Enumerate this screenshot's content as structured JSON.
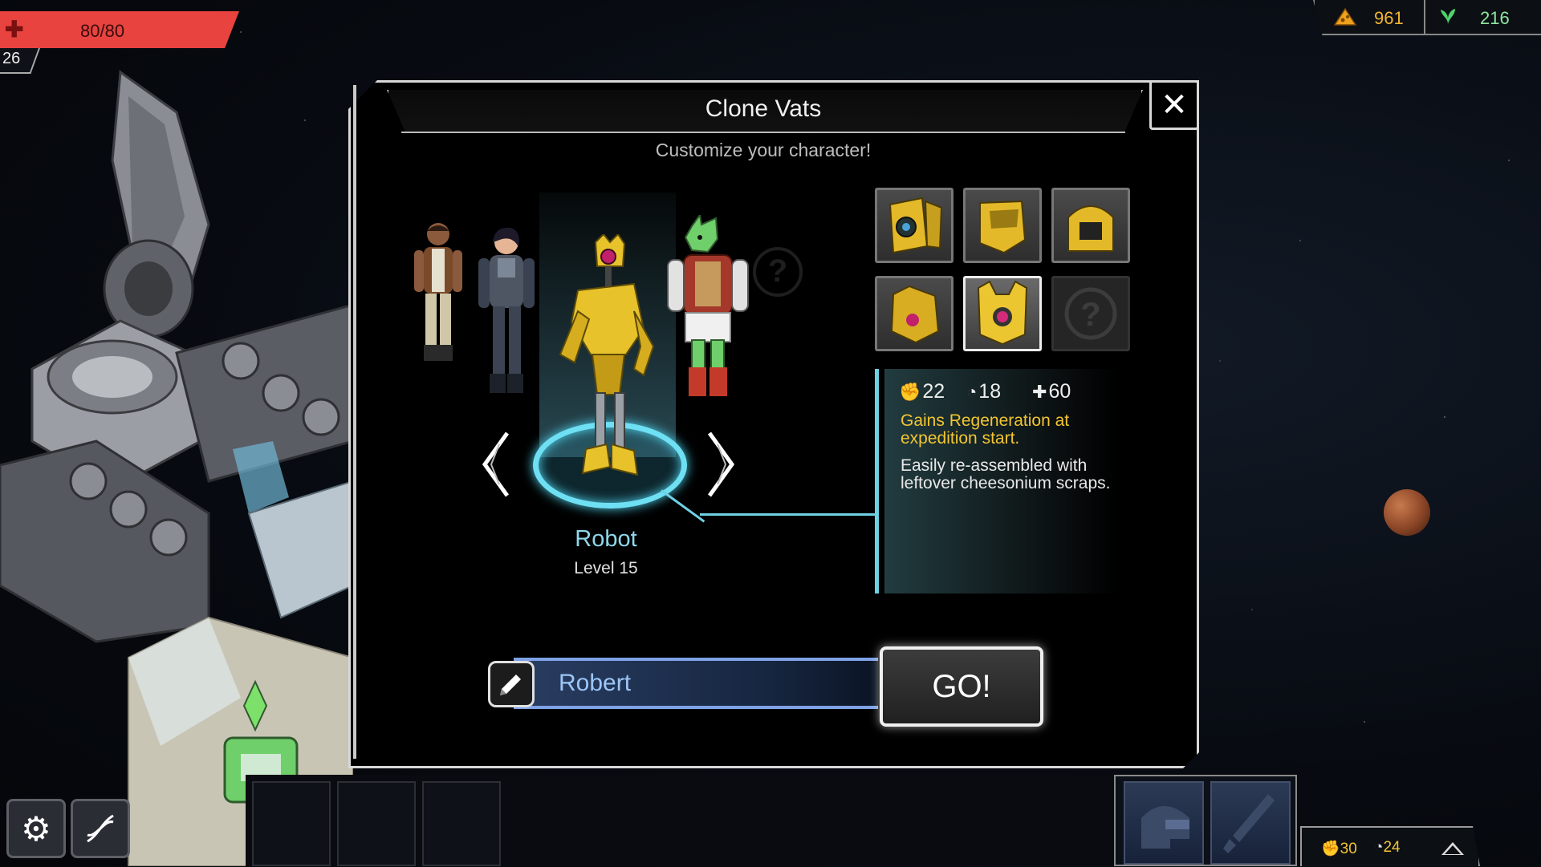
{
  "hud": {
    "health": "80/80",
    "player_level": "26",
    "resource_cheese": "961",
    "resource_herb": "216"
  },
  "dialog": {
    "title": "Clone Vats",
    "subtitle": "Customize your character!",
    "close_label": "✕"
  },
  "character": {
    "name": "Robot",
    "level": "Level 15",
    "stats": {
      "attack": "22",
      "speed": "18",
      "health": "60"
    },
    "ability": "Gains Regeneration at expedition start.",
    "description": "Easily re-assembled with leftover cheesonium scraps.",
    "arrow_prev": "‹",
    "arrow_next": "›",
    "unknown_mark": "?"
  },
  "portraits": [
    {
      "name": "robot-head-variant-1",
      "state": "normal"
    },
    {
      "name": "robot-head-variant-2",
      "state": "normal"
    },
    {
      "name": "robot-head-variant-3",
      "state": "normal"
    },
    {
      "name": "robot-head-variant-4",
      "state": "normal"
    },
    {
      "name": "robot-head-variant-5",
      "state": "selected"
    },
    {
      "name": "locked-variant",
      "state": "locked",
      "label": "?"
    }
  ],
  "name_input": {
    "value": "Robert"
  },
  "go_button": "GO!",
  "bottom_hud": {
    "attack": "30",
    "speed": "24"
  },
  "colors": {
    "accent_cyan": "#6fd1e4",
    "ability_gold": "#f2c531",
    "health_red": "#e8433f",
    "name_blue": "#9cc6f7"
  },
  "icons": [
    "health-cross-icon",
    "cheese-icon",
    "herb-icon",
    "close-icon",
    "attack-fist-icon",
    "speed-icon",
    "health-plus-icon",
    "pencil-icon",
    "settings-gear-icon",
    "dna-icon",
    "helmet-icon",
    "sword-icon",
    "expand-arrow-icon"
  ]
}
